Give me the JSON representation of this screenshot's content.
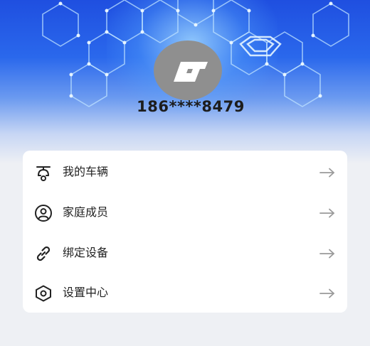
{
  "profile": {
    "phone": "186****8479",
    "avatar_icon": "app-logo-icon"
  },
  "menu": {
    "items": [
      {
        "label": "我的车辆",
        "icon": "scooter-icon"
      },
      {
        "label": "家庭成员",
        "icon": "user-circle-icon"
      },
      {
        "label": "绑定设备",
        "icon": "link-icon"
      },
      {
        "label": "设置中心",
        "icon": "settings-hexagon-icon"
      }
    ],
    "arrow_icon": "arrow-right-icon"
  },
  "colors": {
    "header_top": "#1f4fe0",
    "header_mid": "#2a68ec",
    "background": "#eef0f4",
    "card": "#ffffff",
    "avatar": "#8f8f8f",
    "text": "#222222",
    "arrow": "#9a9a9a"
  }
}
